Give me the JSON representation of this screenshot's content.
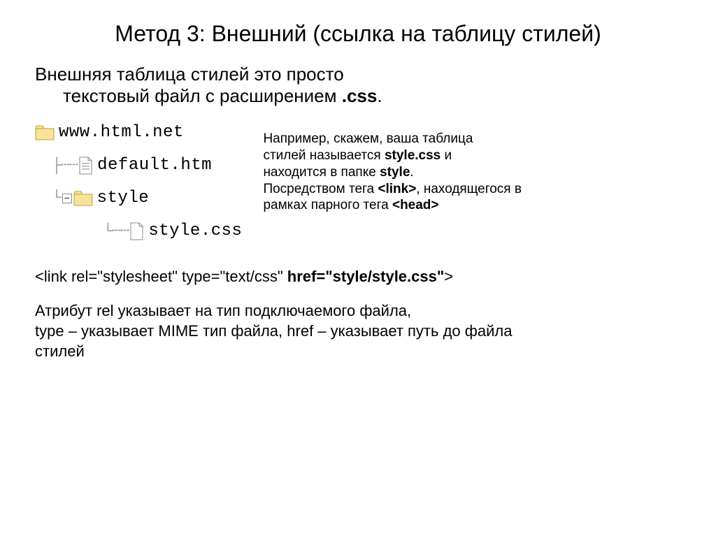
{
  "title": "Метод 3: Внешний (ссылка на таблицу стилей)",
  "intro_line1": "Внешняя таблица стилей это просто",
  "intro_line2_a": "текстовый файл с расширением ",
  "intro_line2_b": ".css",
  "intro_period": ".",
  "tree": {
    "root": "www.html.net",
    "file1": "default.htm",
    "folder2": "style",
    "file2": "style.css"
  },
  "side": {
    "l1a": "Например, скажем, ваша таблица",
    "l1b": "стилей называется ",
    "l1c": "style.css",
    "l1d": " и",
    "l2a": "находится в папке ",
    "l2b": "style",
    "l2c": ".",
    "l3a": "Посредством тега ",
    "l3b": "<link>",
    "l3c": ", находящегося в",
    "l4a": "рамках парного тега ",
    "l4b": "<head>"
  },
  "code": {
    "a": "<link rel=\"stylesheet\" type=\"text/css\" ",
    "b": "href=\"style/style.css\"",
    "c": ">"
  },
  "explain": {
    "l1": "Атрибут rel указывает на тип подключаемого файла,",
    "l2": "type – указывает MIME тип файла, href – указывает путь до файла",
    "l3": "стилей"
  }
}
